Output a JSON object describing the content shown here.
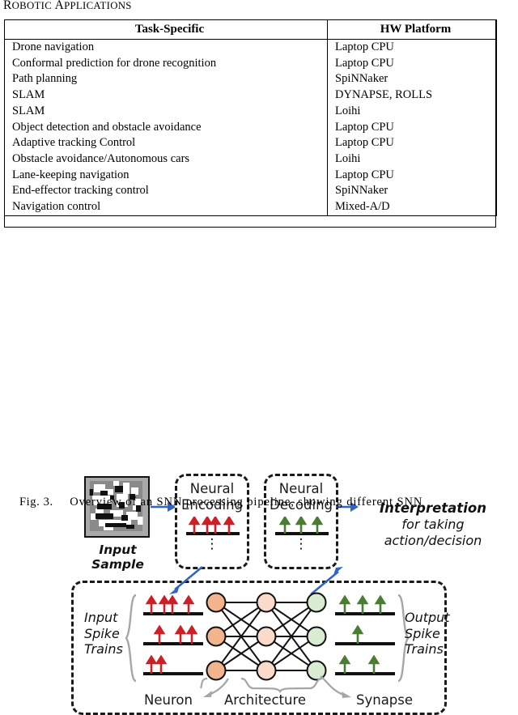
{
  "section": {
    "heading_pre": "R",
    "heading_rest": "OBOTIC ",
    "heading_pre2": "A",
    "heading_rest2": "PPLICATIONS",
    "heading_full": "Robotic Applications"
  },
  "table": {
    "columns": [
      "Task-Specific",
      "HW Platform"
    ],
    "rows": [
      [
        "Drone navigation",
        "Laptop CPU"
      ],
      [
        "Conformal prediction for drone recognition",
        "Laptop CPU"
      ],
      [
        "Path planning",
        "SpiNNaker"
      ],
      [
        "SLAM",
        "DYNAPSE, ROLLS"
      ],
      [
        "SLAM",
        "Loihi"
      ],
      [
        "Object detection and obstacle avoidance",
        "Laptop CPU"
      ],
      [
        "Adaptive tracking Control",
        "Laptop CPU"
      ],
      [
        "Obstacle avoidance/Autonomous cars",
        "Loihi"
      ],
      [
        "Lane-keeping navigation",
        "Laptop CPU"
      ],
      [
        "End-effector tracking control",
        "SpiNNaker"
      ],
      [
        "Navigation control",
        "Mixed-A/D"
      ]
    ]
  },
  "figure": {
    "input_sample_label": "Input Sample",
    "encoding": {
      "line1": "Neural",
      "line2": "Encoding",
      "spikes": 4,
      "dots": "⋮"
    },
    "decoding": {
      "line1": "Neural",
      "line2": "Decoding",
      "spikes": 3,
      "dots": "⋮"
    },
    "interpretation": {
      "title": "Interpretation",
      "sub1": "for taking",
      "sub2": "action/decision"
    },
    "snn": {
      "left_label_lines": [
        "Input",
        "Spike",
        "Trains"
      ],
      "right_label_lines": [
        "Output",
        "Spike",
        "Trains"
      ],
      "input_spike_counts": [
        4,
        3,
        2
      ],
      "output_spike_counts": [
        3,
        1,
        2
      ],
      "layers": [
        {
          "name": "input-layer",
          "nodes": 3,
          "color": "#f2b48c"
        },
        {
          "name": "hidden-layer",
          "nodes": 3,
          "color": "#fadbc9"
        },
        {
          "name": "output-layer",
          "nodes": 3,
          "color": "#d9ecd2"
        }
      ],
      "annotations": [
        "Neuron",
        "Architecture",
        "Synapse"
      ]
    },
    "colors": {
      "input_spike": "#cc2026",
      "output_spike": "#4a7c33",
      "arrow": "#2f65c4",
      "brace": "#a6a6a6",
      "box_border": "#1a1a1a"
    }
  },
  "caption": {
    "figno": "Fig. 3.",
    "text": "Overview of an SNN processing pipeline, showing different SNN"
  }
}
